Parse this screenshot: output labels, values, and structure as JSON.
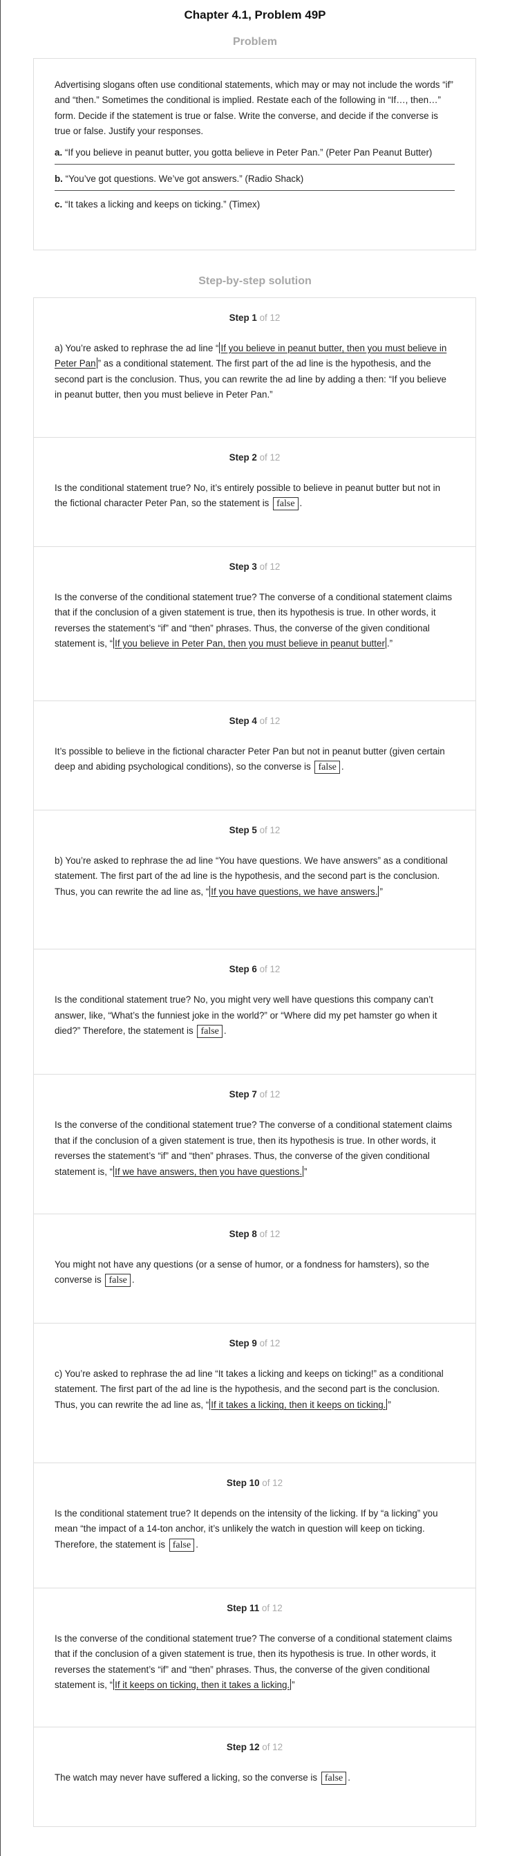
{
  "page": {
    "title": "Chapter 4.1, Problem 49P",
    "problem_heading": "Problem",
    "solution_heading": "Step-by-step solution"
  },
  "problem": {
    "intro": "Advertising slogans often use conditional statements, which may or may not include the words “if” and “then.” Sometimes the conditional is implied. Restate each of the following in “If…, then…” form. Decide if the statement is true or false. Write the converse, and decide if the converse is true or false. Justify your responses.",
    "parts": [
      {
        "label": "a.",
        "text": "“If you believe in peanut butter, you gotta believe in Peter Pan.” (Peter Pan Peanut Butter)"
      },
      {
        "label": "b.",
        "text": "“You’ve got questions. We’ve got answers.” (Radio Shack)"
      },
      {
        "label": "c.",
        "text": "“It takes a licking and keeps on ticking.” (Timex)"
      }
    ]
  },
  "steps": [
    {
      "label": "Step 1",
      "of": "of 12",
      "pre": "a) You’re asked to rephrase the ad line “",
      "answer": "If you believe in peanut butter, then you must believe in Peter Pan",
      "post": "” as a conditional statement. The first part of the ad line is the hypothesis, and the second part is the conclusion. Thus, you can rewrite the ad line by adding a then: “If you believe in peanut butter, then you must believe in Peter Pan.”"
    },
    {
      "label": "Step 2",
      "of": "of 12",
      "pre": "Is the conditional statement true? No, it’s entirely possible to believe in peanut butter but not in the fictional character Peter Pan, so the statement is ",
      "box": "false",
      "post": "."
    },
    {
      "label": "Step 3",
      "of": "of 12",
      "pre": "Is the converse of the conditional statement true? The converse of a conditional statement claims that if the conclusion of a given statement is true, then its hypothesis is true. In other words, it reverses the statement’s “if” and “then” phrases. Thus, the converse of the given conditional statement is, “",
      "answer": "If you believe in Peter Pan, then you must believe in peanut butter",
      "post": ".”"
    },
    {
      "label": "Step 4",
      "of": "of 12",
      "pre": "It’s possible to believe in the fictional character Peter Pan but not in peanut butter (given certain deep and abiding psychological conditions), so the converse is ",
      "box": "false",
      "post": "."
    },
    {
      "label": "Step 5",
      "of": "of 12",
      "pre": "b) You’re asked to rephrase the ad line “You have questions. We have answers” as a conditional statement. The first part of the ad line is the hypothesis, and the second part is the conclusion. Thus, you can rewrite the ad line as, “",
      "answer": "If you have questions, we have answers.",
      "post": "”"
    },
    {
      "label": "Step 6",
      "of": "of 12",
      "pre": "Is the conditional statement true? No, you might very well have questions this company can’t answer, like, “What’s the funniest joke in the world?” or “Where did my pet hamster go when it died?” Therefore, the statement is ",
      "box": "false",
      "post": "."
    },
    {
      "label": "Step 7",
      "of": "of 12",
      "pre": "Is the converse of the conditional statement true? The converse of a conditional statement claims that if the conclusion of a given statement is true, then its hypothesis is true. In other words, it reverses the statement’s “if” and “then” phrases. Thus, the converse of the given conditional statement is, “",
      "answer": "If we have answers, then you have questions.",
      "post": "”"
    },
    {
      "label": "Step 8",
      "of": "of 12",
      "pre": "You might not have any questions (or a sense of humor, or a fondness for hamsters), so the converse is ",
      "box": "false",
      "post": "."
    },
    {
      "label": "Step 9",
      "of": "of 12",
      "pre": "c) You’re asked to rephrase the ad line “It takes a licking and keeps on ticking!” as a conditional statement. The first part of the ad line is the hypothesis, and the second part is the conclusion. Thus, you can rewrite the ad line as, “",
      "answer": "If it takes a licking, then it keeps on ticking.",
      "post": "”"
    },
    {
      "label": "Step 10",
      "of": "of 12",
      "pre": "Is the conditional statement true? It depends on the intensity of the licking. If by “a licking” you mean “the impact of a 14-ton anchor, it’s unlikely the watch in question will keep on ticking. Therefore, the statement is ",
      "box": "false",
      "post": "."
    },
    {
      "label": "Step 11",
      "of": "of 12",
      "pre": "Is the converse of the conditional statement true? The converse of a conditional statement claims that if the conclusion of a given statement is true, then its hypothesis is true. In other words, it reverses the statement’s “if” and “then” phrases. Thus, the converse of the given conditional statement is, “",
      "answer": "If it keeps on ticking, then it takes a licking.",
      "post": "”"
    },
    {
      "label": "Step 12",
      "of": "of 12",
      "pre": "The watch may never have suffered a licking, so the converse is ",
      "box": "false",
      "post": "."
    }
  ]
}
